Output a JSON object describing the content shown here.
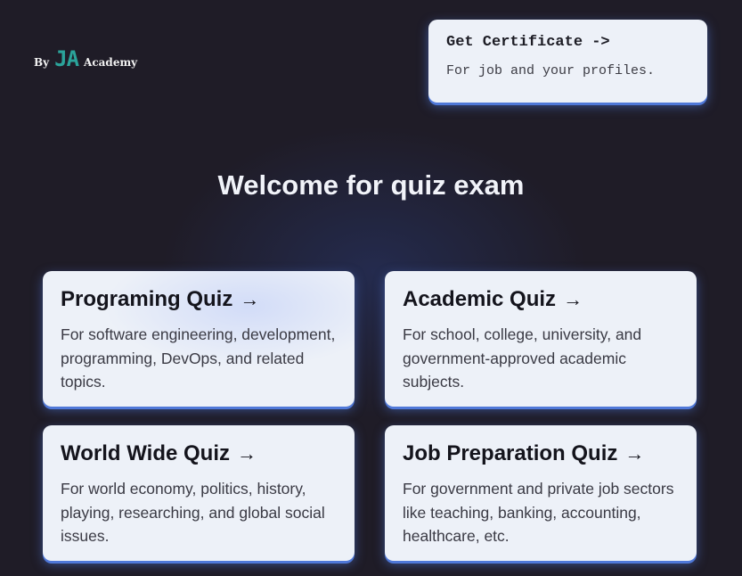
{
  "brand": {
    "prefix": "By",
    "logo": "JA",
    "suffix": "Academy"
  },
  "certificate": {
    "title": "Get Certificate ->",
    "subtitle": "For job and your profiles."
  },
  "heading": "Welcome for quiz exam",
  "quizzes": [
    {
      "title": "Programing Quiz",
      "description": "For software engineering, development, programming, DevOps, and related topics."
    },
    {
      "title": "Academic Quiz",
      "description": "For school, college, university, and government-approved academic subjects."
    },
    {
      "title": "World Wide Quiz",
      "description": "For world economy, politics, history, playing, researching, and global social issues."
    },
    {
      "title": "Job Preparation Quiz",
      "description": "For government and private job sectors like teaching, banking, accounting, healthcare, etc."
    }
  ],
  "icons": {
    "arrow": "arrow-right-icon"
  },
  "colors": {
    "background": "#1f1c27",
    "card": "#edf1f8",
    "accent": "#4f78d8",
    "logo": "#2ba39a"
  }
}
